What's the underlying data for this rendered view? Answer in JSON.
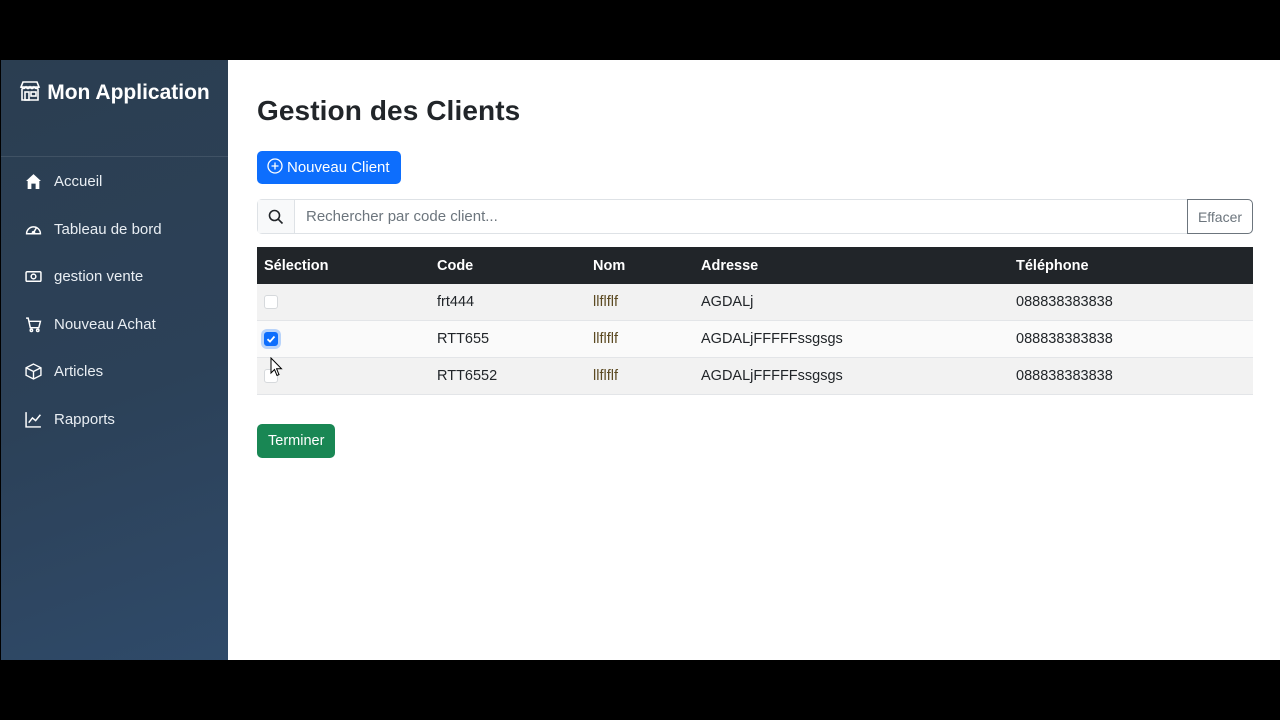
{
  "sidebar": {
    "brand": "Mon Application",
    "items": [
      {
        "label": "Accueil",
        "icon": "house-icon"
      },
      {
        "label": "Tableau de bord",
        "icon": "speedometer-icon"
      },
      {
        "label": "gestion vente",
        "icon": "cash-icon"
      },
      {
        "label": "Nouveau Achat",
        "icon": "cart-icon"
      },
      {
        "label": "Articles",
        "icon": "box-icon"
      },
      {
        "label": "Rapports",
        "icon": "chart-line-icon"
      }
    ]
  },
  "main": {
    "title": "Gestion des Clients",
    "new_client_label": "Nouveau Client",
    "search_placeholder": "Rechercher par code client...",
    "search_value": "",
    "clear_label": "Effacer",
    "table": {
      "headers": [
        "Sélection",
        "Code",
        "Nom",
        "Adresse",
        "Téléphone"
      ],
      "rows": [
        {
          "selected": false,
          "code": "frt444",
          "nom": "llflflf",
          "adresse": "AGDALj",
          "telephone": "088838383838"
        },
        {
          "selected": true,
          "code": "RTT655",
          "nom": "llflflf",
          "adresse": "AGDALjFFFFFssgsgs",
          "telephone": "088838383838"
        },
        {
          "selected": false,
          "code": "RTT6552",
          "nom": "llflflf",
          "adresse": "AGDALjFFFFFssgsgs",
          "telephone": "088838383838"
        }
      ]
    },
    "done_label": "Terminer"
  },
  "colors": {
    "sidebar": "#2c4158",
    "primary": "#0d6efd",
    "success": "#198754",
    "table_header": "#212529"
  }
}
